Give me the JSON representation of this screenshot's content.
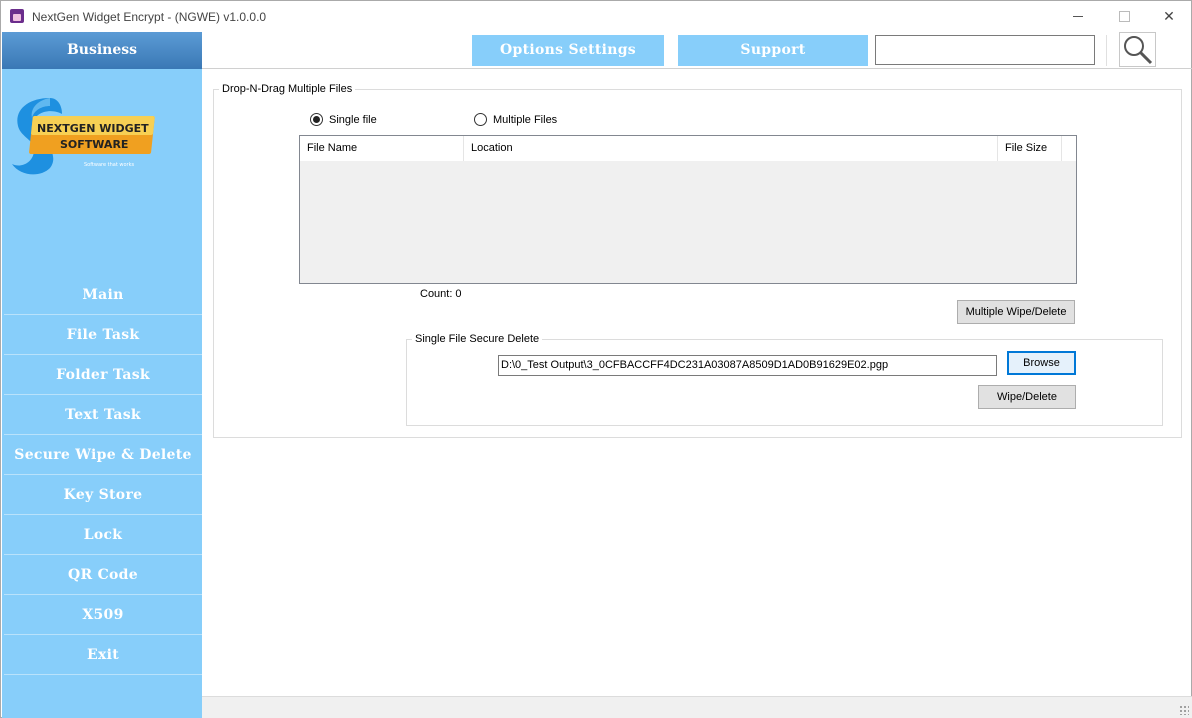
{
  "window": {
    "title": "NextGen Widget Encrypt - (NGWE) v1.0.0.0",
    "controls": {
      "minimize": "",
      "maximize": "",
      "close": "✕"
    }
  },
  "sidebar": {
    "header": "Business",
    "logo": {
      "line1": "NEXTGEN WIDGET",
      "line2": "SOFTWARE",
      "tagline": "Software that works"
    },
    "items": [
      {
        "label": "Main"
      },
      {
        "label": "File Task"
      },
      {
        "label": "Folder Task"
      },
      {
        "label": "Text Task"
      },
      {
        "label": "Secure Wipe & Delete"
      },
      {
        "label": "Key Store"
      },
      {
        "label": "Lock"
      },
      {
        "label": "QR Code"
      },
      {
        "label": "X509"
      },
      {
        "label": "Exit"
      }
    ]
  },
  "topbar": {
    "options_label": "Options Settings",
    "support_label": "Support",
    "search_value": "",
    "search_icon": "magnifier-icon"
  },
  "drop_group": {
    "label": "Drop-N-Drag Multiple Files",
    "radio_single": "Single file",
    "radio_multiple": "Multiple Files",
    "selected": "single",
    "columns": [
      "File Name",
      "Location",
      "File Size"
    ],
    "rows": [],
    "count_label": "Count:",
    "count_value": "0",
    "multi_wipe_label": "Multiple Wipe/Delete"
  },
  "single_group": {
    "label": "Single File Secure Delete",
    "path_value": "D:\\0_Test Output\\3_0CFBACCFF4DC231A03087A8509D1AD0B91629E02.pgp",
    "browse_label": "Browse",
    "wipe_label": "Wipe/Delete"
  },
  "colors": {
    "sidebar_bg": "#87cefa",
    "sidebar_header": "#4a89c8",
    "accent_focus": "#0078d7"
  }
}
